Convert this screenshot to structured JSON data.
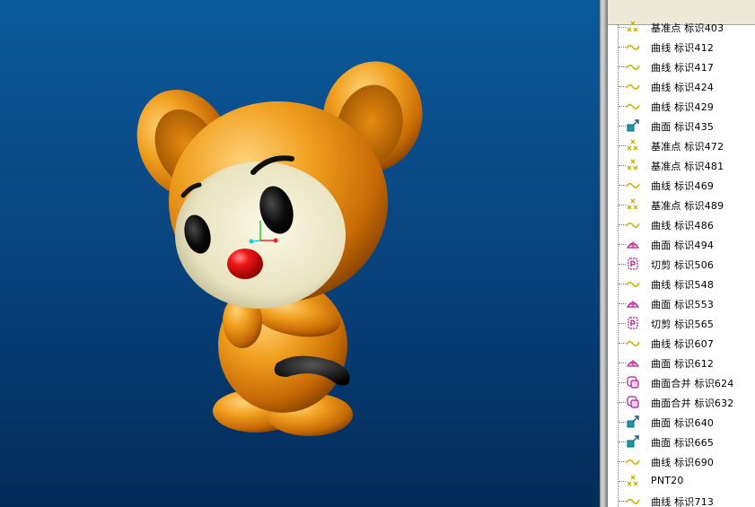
{
  "tree": {
    "items": [
      {
        "icon": "datum-point-icon",
        "label": "基准点 标识403"
      },
      {
        "icon": "curve-icon",
        "label": "曲线 标识412"
      },
      {
        "icon": "curve-icon",
        "label": "曲线 标识417"
      },
      {
        "icon": "curve-icon",
        "label": "曲线 标识424"
      },
      {
        "icon": "curve-icon",
        "label": "曲线 标识429"
      },
      {
        "icon": "surface-icon",
        "label": "曲面 标识435"
      },
      {
        "icon": "datum-point-icon",
        "label": "基准点 标识472"
      },
      {
        "icon": "datum-point-icon",
        "label": "基准点 标识481"
      },
      {
        "icon": "curve-icon",
        "label": "曲线 标识469"
      },
      {
        "icon": "datum-point-icon",
        "label": "基准点 标识489"
      },
      {
        "icon": "curve-icon",
        "label": "曲线 标识486"
      },
      {
        "icon": "boundary-surface-icon",
        "label": "曲面 标识494"
      },
      {
        "icon": "trim-icon",
        "label": "切剪 标识506"
      },
      {
        "icon": "curve-icon",
        "label": "曲线 标识548"
      },
      {
        "icon": "boundary-surface-icon",
        "label": "曲面 标识553"
      },
      {
        "icon": "trim-icon",
        "label": "切剪 标识565"
      },
      {
        "icon": "curve-icon",
        "label": "曲线 标识607"
      },
      {
        "icon": "boundary-surface-icon",
        "label": "曲面 标识612"
      },
      {
        "icon": "merge-icon",
        "label": "曲面合并 标识624"
      },
      {
        "icon": "merge-icon",
        "label": "曲面合并 标识632"
      },
      {
        "icon": "surface-icon",
        "label": "曲面 标识640"
      },
      {
        "icon": "surface-icon",
        "label": "曲面 标识665"
      },
      {
        "icon": "curve-icon",
        "label": "曲线 标识690"
      },
      {
        "icon": "datum-point-icon",
        "label": "PNT20"
      },
      {
        "icon": "curve-icon",
        "label": "曲线 标识713"
      }
    ]
  },
  "colors": {
    "background_top": "#0a5a9a",
    "background_bottom": "#032b58",
    "model_orange": "#e8900f",
    "face_cream": "#f0ecd0",
    "nose_red": "#e01010"
  }
}
